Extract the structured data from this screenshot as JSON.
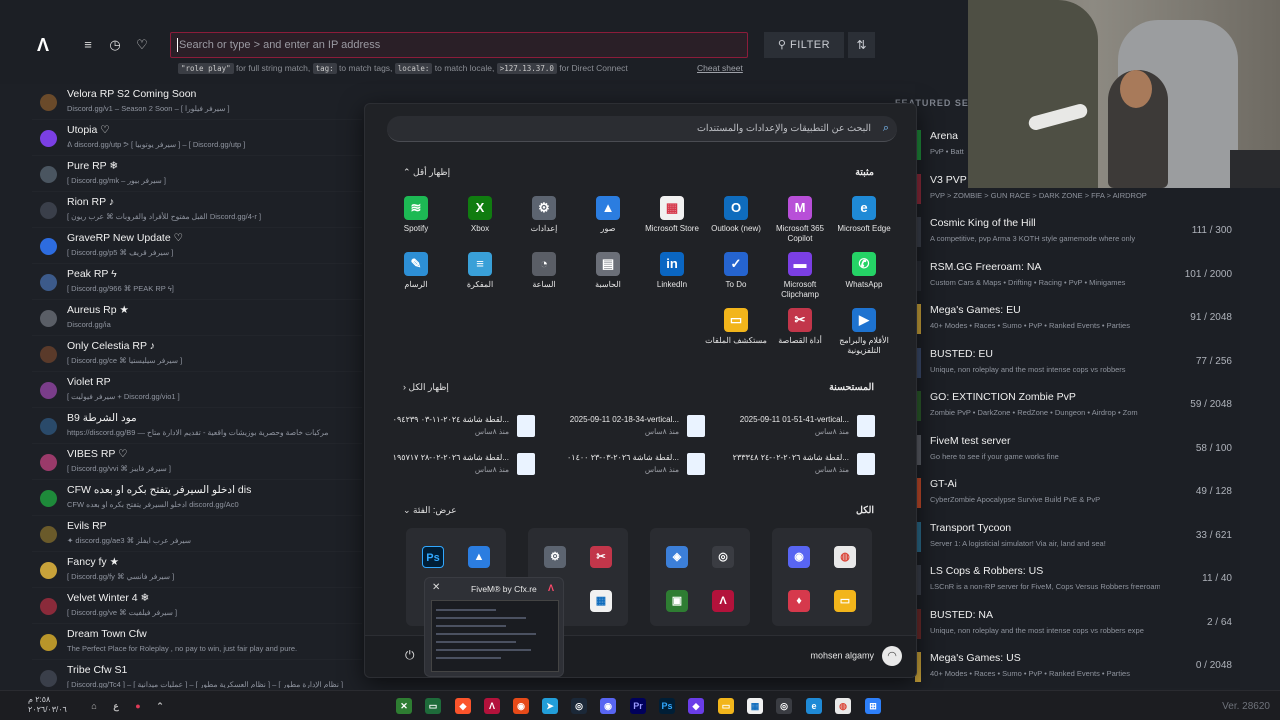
{
  "topbar": {
    "search_placeholder": "Search or type > and enter an IP address",
    "hint_1_tag": "\"role play\"",
    "hint_1_text": "for full string match,",
    "hint_2_tag": "tag:",
    "hint_2_text": "to match tags,",
    "hint_3_tag": "locale:",
    "hint_3_text": "to match locale,",
    "hint_4_tag": ">127.13.37.0",
    "hint_4_text": "for Direct Connect",
    "cheat_sheet": "Cheat sheet",
    "filter_label": "FILTER"
  },
  "servers": [
    {
      "name": "Velora RP S2 Coming Soon",
      "desc": "Discord.gg/v1 – Season 2 Soon – [ سيرفر فيلورا ]"
    },
    {
      "name": "Utopia ♡",
      "desc": "ᕕ discord.gg/utp ᕗ [ سيرفر يوتوبيا ] – [ Discord.gg/utp ]"
    },
    {
      "name": "Pure RP ❄",
      "desc": "[ Discord.gg/mk – سيرفر بيور ]"
    },
    {
      "name": "Rion RP ♪",
      "desc": "[ القبل مفتوح للأفراد والقروبات ⌘ عرب ريون Discord.gg/4-r ]"
    },
    {
      "name": "GraveRP New Update ♡",
      "desc": "[ Discord.gg/p5 ⌘ سيرفر قريف ]"
    },
    {
      "name": "Peak RP ϟ",
      "desc": "[ Discord.gg/966 ⌘ PEAK RP ϟ]"
    },
    {
      "name": "Aureus Rp ★",
      "desc": "Discord.gg/ia"
    },
    {
      "name": "Only Celestia RP ♪",
      "desc": "[ Discord.gg/ce ⌘ سيرفر سيليستيا ]"
    },
    {
      "name": "Violet RP",
      "desc": "[ سيرفر فيوليت + Discord.gg/vio1 ]"
    },
    {
      "name": "B9 مود الشرطة",
      "desc": "https://discord.gg/B9 — مركبات خاصة وحصرية بوزيشات واقعية - تقديم الادارة متاح"
    },
    {
      "name": "VIBES RP ♡",
      "desc": "[ Discord.gg/vvi ⌘ سيرفر فايبز ]"
    },
    {
      "name": "CFW ادخلو السيرفر يتفتح بكره او بعده dis",
      "desc": "CFW ادخلو السيرفر يتفتح بكره او بعده discord.gg/Ac0"
    },
    {
      "name": "Evils RP",
      "desc": "✦ discord.gg/ae3 ⌘ سيرفر عرب ايفلز"
    },
    {
      "name": "Fancy fy ★",
      "desc": "[ Discord.gg/fy ⌘ سيرفر فانسي ]"
    },
    {
      "name": "Velvet Winter 4 ❄",
      "desc": "[ Discord.gg/ve ⌘ سيرفر فيلفيت ]"
    },
    {
      "name": "Dream Town Cfw",
      "desc": "The Perfect Place for Roleplay , no pay to win, just fair play and pure."
    },
    {
      "name": "Tribe Cfw S1",
      "desc": "[ Discord.gg/Tc4 ] – [ عمليات ميدانية ] – [ نظام العسكرية مطور ] – [ نظام الإدارة مطور ]"
    }
  ],
  "featured": {
    "header": "FEATURED SERV",
    "rows": [
      {
        "name": "Arena",
        "desc": "PvP • Batt",
        "count": ""
      },
      {
        "name": "V3 PVP",
        "desc": "PVP > ZOMBIE > GUN RACE > DARK ZONE > FFA > AIRDROP",
        "count": ""
      },
      {
        "name": "Cosmic King of the Hill",
        "desc": "A competitive, pvp Arma 3 KOTH style gamemode where only",
        "count": "111 / 300"
      },
      {
        "name": "RSM.GG Freeroam: NA",
        "desc": "Custom Cars & Maps • Drifting • Racing • PvP • Minigames",
        "count": "101 / 2000"
      },
      {
        "name": "Mega's Games: EU",
        "desc": "40+ Modes • Races • Sumo • PvP • Ranked Events • Parties",
        "count": "91 / 2048"
      },
      {
        "name": "BUSTED: EU",
        "desc": "Unique, non roleplay and the most intense cops vs robbers",
        "count": "77 / 256"
      },
      {
        "name": "GO: EXTINCTION Zombie PvP",
        "desc": "Zombie PvP • DarkZone • RedZone • Dungeon • Airdrop • Zom",
        "count": "59 / 2048"
      },
      {
        "name": "FiveM test server",
        "desc": "Go here to see if your game works fine",
        "count": "58 / 100"
      },
      {
        "name": "GT-Ai",
        "desc": "CyberZombie Apocalypse Survive Build PvE & PvP",
        "count": "49 / 128"
      },
      {
        "name": "Transport Tycoon",
        "desc": "Server 1: A logisticial simulator! Via air, land and sea!",
        "count": "33 / 621"
      },
      {
        "name": "LS Cops & Robbers: US",
        "desc": "LSCnR is a non-RP server for FiveM, Cops Versus Robbers freeroam",
        "count": "11 / 40"
      },
      {
        "name": "BUSTED: NA",
        "desc": "Unique, non roleplay and the most intense cops vs robbers expe",
        "count": "2 / 64"
      },
      {
        "name": "Mega's Games: US",
        "desc": "40+ Modes • Races • Sumo • PvP • Ranked Events • Parties",
        "count": "0 / 2048"
      }
    ]
  },
  "start_menu": {
    "search_placeholder": "البحث عن التطبيقات والإعدادات والمستندات",
    "pinned_label": "مثبتة",
    "show_less": "إظهار أقل",
    "apps": [
      {
        "label": "Microsoft Edge",
        "icon": "edge-icon",
        "color": "#1f8ad6",
        "glyph": "e"
      },
      {
        "label": "Microsoft 365 Copilot",
        "icon": "m365-icon",
        "color": "#b84fd8",
        "glyph": "M"
      },
      {
        "label": "Outlook (new)",
        "icon": "outlook-icon",
        "color": "#0f6cbd",
        "glyph": "O"
      },
      {
        "label": "Microsoft Store",
        "icon": "store-icon",
        "color": "#f1f1f1",
        "glyph": "▦"
      },
      {
        "label": "صور",
        "icon": "photos-icon",
        "color": "#2b7de0",
        "glyph": "▲"
      },
      {
        "label": "إعدادات",
        "icon": "settings-icon",
        "color": "#5c6470",
        "glyph": "⚙"
      },
      {
        "label": "Xbox",
        "icon": "xbox-icon",
        "color": "#107c10",
        "glyph": "X"
      },
      {
        "label": "Spotify",
        "icon": "spotify-icon",
        "color": "#1db954",
        "glyph": "≋"
      },
      {
        "label": "WhatsApp",
        "icon": "whatsapp-icon",
        "color": "#25d366",
        "glyph": "✆"
      },
      {
        "label": "Microsoft Clipchamp",
        "icon": "clipchamp-icon",
        "color": "#7b3fe4",
        "glyph": "▬"
      },
      {
        "label": "To Do",
        "icon": "todo-icon",
        "color": "#2564cf",
        "glyph": "✓"
      },
      {
        "label": "LinkedIn",
        "icon": "linkedin-icon",
        "color": "#0a66c2",
        "glyph": "in"
      },
      {
        "label": "الحاسبة",
        "icon": "calculator-icon",
        "color": "#6b6f78",
        "glyph": "▤"
      },
      {
        "label": "الساعة",
        "icon": "clock-icon",
        "color": "#5a5e66",
        "glyph": "◔"
      },
      {
        "label": "المفكرة",
        "icon": "notepad-icon",
        "color": "#39a0d8",
        "glyph": "≡"
      },
      {
        "label": "الرسام",
        "icon": "paint-icon",
        "color": "#2d8fd5",
        "glyph": "✎"
      },
      {
        "label": "الأفلام والبرامج التلفزيونية",
        "icon": "movies-icon",
        "color": "#1e73d0",
        "glyph": "▶"
      },
      {
        "label": "أداة القصاصة",
        "icon": "snipping-icon",
        "color": "#c2364a",
        "glyph": "✂"
      },
      {
        "label": "مستكشف الملفات",
        "icon": "explorer-icon",
        "color": "#f2b51b",
        "glyph": "▭"
      }
    ],
    "recommended_label": "المستحسنة",
    "show_all": "إظهار الكل",
    "recent": [
      {
        "name": "2025-09-11 01-51-41-vertical...",
        "time": "منذ ٨ساس"
      },
      {
        "name": "2025-09-11 02-18-34-vertical...",
        "time": "منذ ٨ساس"
      },
      {
        "name": "لقطة شاشة ٢٠٢٤-١١-٠٣ ٠٩٤٢٣٩...",
        "time": "منذ ٨ساس"
      },
      {
        "name": "لقطة شاشة ٢٠٢٦-٠٢-٢٤ ٢٣٣٣٤٨...",
        "time": "منذ ٨ساس"
      },
      {
        "name": "لقطة شاشة ٢٠٢٦-٠٣-٢٣ ٠١٤٠٠...",
        "time": "منذ ٨ساس"
      },
      {
        "name": "لقطة شاشة ٢٠٢٦-٠٢-٢٨ ١٩٥٧١٧...",
        "time": "منذ ٨ساس"
      }
    ],
    "all_label": "الكل",
    "view_label": "عرض: الفئة",
    "user_name": "mohsen algamy"
  },
  "preview": {
    "title": "FiveM® by Cfx.re"
  },
  "taskbar": {
    "time": "٢:٥٨ م",
    "date": "٢٠٢٦/٠٣/٠٦",
    "version": "Ver. 28620"
  },
  "colors": {
    "accent": "#e0214a",
    "search_border": "#8b1c3a"
  }
}
